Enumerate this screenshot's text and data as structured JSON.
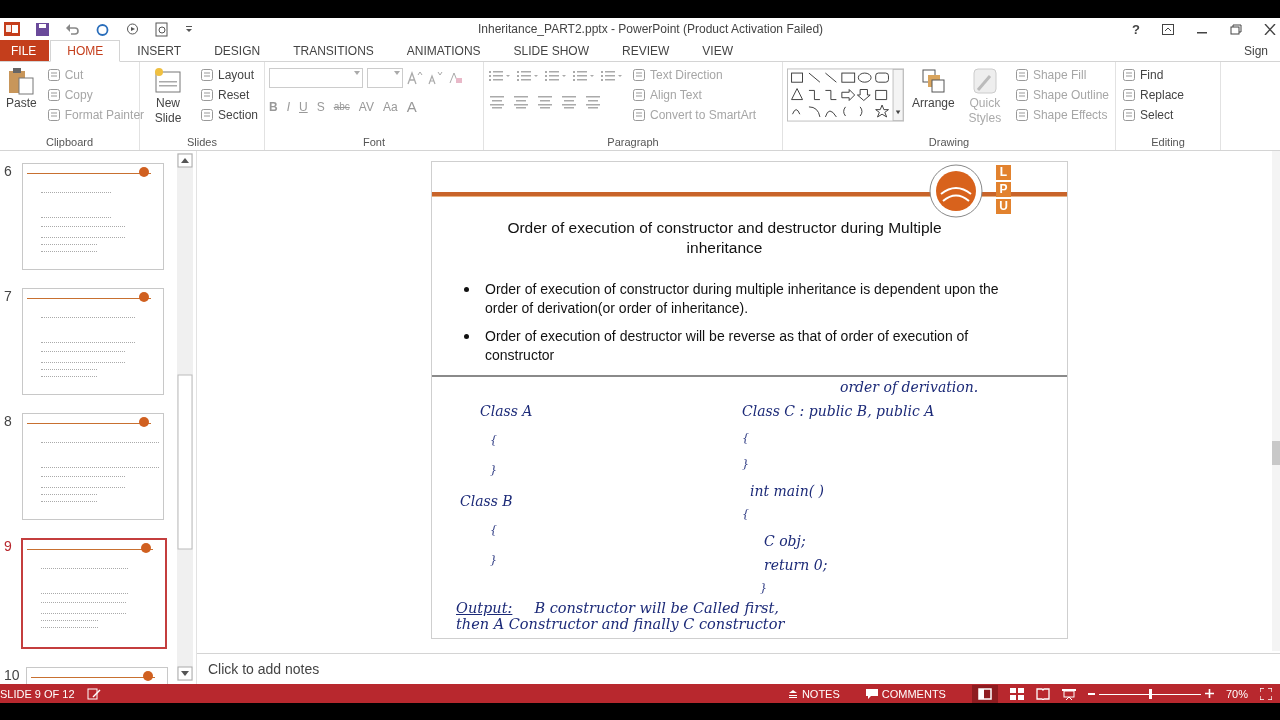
{
  "window": {
    "title": "Inheritance_PART2.pptx - PowerPoint (Product Activation Failed)",
    "help": "?"
  },
  "tabs": [
    {
      "label": "FILE",
      "kind": "file",
      "selected": false
    },
    {
      "label": "HOME",
      "kind": "tab",
      "selected": true
    },
    {
      "label": "INSERT",
      "kind": "tab",
      "selected": false
    },
    {
      "label": "DESIGN",
      "kind": "tab",
      "selected": false
    },
    {
      "label": "TRANSITIONS",
      "kind": "tab",
      "selected": false
    },
    {
      "label": "ANIMATIONS",
      "kind": "tab",
      "selected": false
    },
    {
      "label": "SLIDE SHOW",
      "kind": "tab",
      "selected": false
    },
    {
      "label": "REVIEW",
      "kind": "tab",
      "selected": false
    },
    {
      "label": "VIEW",
      "kind": "tab",
      "selected": false
    }
  ],
  "sign_in": "Sign",
  "ribbon": [
    {
      "kind": "clipboard",
      "label": "Clipboard",
      "large": [
        {
          "label": "Paste",
          "disabled": false
        }
      ],
      "small": [
        {
          "label": "Cut",
          "disabled": true
        },
        {
          "label": "Copy",
          "disabled": true
        },
        {
          "label": "Format Painter",
          "disabled": true
        }
      ]
    },
    {
      "kind": "slides",
      "label": "Slides",
      "large": [
        {
          "label": "New Slide",
          "disabled": false
        }
      ],
      "small": [
        {
          "label": "Layout",
          "disabled": false
        },
        {
          "label": "Reset",
          "disabled": false
        },
        {
          "label": "Section",
          "disabled": false
        }
      ]
    },
    {
      "kind": "font",
      "label": "Font",
      "format_buttons": [
        "B",
        "I",
        "U",
        "S",
        "abc",
        "AV",
        "Aa",
        "A"
      ]
    },
    {
      "kind": "paragraph",
      "label": "Paragraph",
      "small": [
        {
          "label": "Text Direction",
          "disabled": true
        },
        {
          "label": "Align Text",
          "disabled": true
        },
        {
          "label": "Convert to SmartArt",
          "disabled": true
        }
      ]
    },
    {
      "kind": "drawing",
      "label": "Drawing",
      "large": [
        {
          "label": "Arrange",
          "disabled": false
        },
        {
          "label": "Quick Styles",
          "disabled": true
        }
      ],
      "small": [
        {
          "label": "Shape Fill",
          "disabled": true
        },
        {
          "label": "Shape Outline",
          "disabled": true
        },
        {
          "label": "Shape Effects",
          "disabled": true
        }
      ]
    },
    {
      "kind": "editing",
      "label": "Editing",
      "small": [
        {
          "label": "Find",
          "disabled": false
        },
        {
          "label": "Replace",
          "disabled": false
        },
        {
          "label": "Select",
          "disabled": false
        }
      ]
    }
  ],
  "thumbnails": [
    {
      "number": "6",
      "selected": false
    },
    {
      "number": "7",
      "selected": false
    },
    {
      "number": "8",
      "selected": false
    },
    {
      "number": "9",
      "selected": true
    },
    {
      "number": "10",
      "selected": false
    }
  ],
  "slide": {
    "title": "Order of execution of constructor and destructor during Multiple inheritance",
    "logo_letters": [
      "L",
      "P",
      "U"
    ],
    "bullets": [
      "Order of execution of constructor during multiple inheritance is dependent upon the order of derivation(or order of inheritance).",
      "Order of execution of destructor will be reverse as that of order of execution of constructor"
    ],
    "handwriting": {
      "annotation": "order of derivation.",
      "left": [
        "Class A",
        "{",
        "}",
        "Class B",
        "{",
        "}"
      ],
      "right": [
        "Class C : public B, public A",
        "{",
        "}",
        "int main( )",
        "{",
        "C obj;",
        "return 0;",
        "}"
      ],
      "output_label": "Output:",
      "output": [
        "B constructor will be Called first,",
        "then A Constructor and finally C constructor"
      ]
    }
  },
  "notes_placeholder": "Click to add notes",
  "status_bar": {
    "slide": "SLIDE 9 OF 12",
    "notes": "NOTES",
    "comments": "COMMENTS",
    "zoom": {
      "level": 0.5
    },
    "zoom_text": "70%"
  }
}
